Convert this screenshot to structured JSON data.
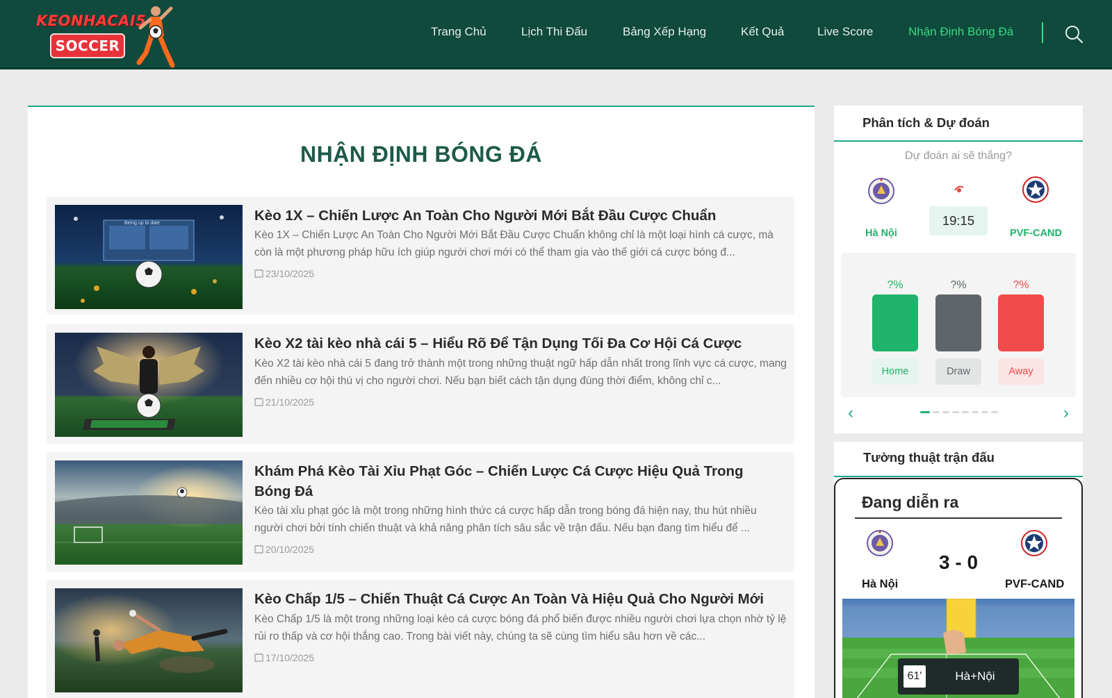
{
  "brand": {
    "line1": "KEONHACAI5",
    "badge": "SOCCER"
  },
  "nav": {
    "items": [
      {
        "label": "Trang Chủ"
      },
      {
        "label": "Lịch Thi Đấu"
      },
      {
        "label": "Bảng Xếp Hạng"
      },
      {
        "label": "Kết Quả"
      },
      {
        "label": "Live Score"
      },
      {
        "label": "Nhận Định Bóng Đá",
        "active": true
      }
    ],
    "search_icon": "search-icon",
    "active_color": "#38d983"
  },
  "main": {
    "title": "NHẬN ĐỊNH BÓNG ĐÁ",
    "articles": [
      {
        "title": "Kèo 1X – Chiến Lược An Toàn Cho Người Mới Bắt Đầu Cược Chuẩn",
        "excerpt": "Kèo 1X – Chiến Lược An Toàn Cho Người Mới Bắt Đầu Cược Chuẩn không chỉ là một loại hình cá cược, mà còn là một phương pháp hữu ích giúp người chơi mới có thể tham gia vào thế giới cá cược bóng đ...",
        "date": "23/10/2025",
        "thumb_text": "Being up to date"
      },
      {
        "title": "Kèo X2 tài kèo nhà cái 5 – Hiểu Rõ Để Tận Dụng Tối Đa Cơ Hội Cá Cược",
        "excerpt": "Kèo X2 tài kèo nhà cái 5 đang trở thành một trong những thuật ngữ hấp dẫn nhất trong lĩnh vực cá cược, mang đến nhiều cơ hội thú vị cho người chơi. Nếu bạn biết cách tận dụng đúng thời điểm, không chỉ c...",
        "date": "21/10/2025"
      },
      {
        "title": "Khám Phá Kèo Tài Xỉu Phạt Góc – Chiến Lược Cá Cược Hiệu Quả Trong Bóng Đá",
        "excerpt": "Kèo tài xỉu phạt góc là một trong những hình thức cá cược hấp dẫn trong bóng đá hiện nay, thu hút nhiều người chơi bởi tính chiến thuật và khả năng phân tích sâu sắc về trận đấu. Nếu bạn đang tìm hiểu để ...",
        "date": "20/10/2025"
      },
      {
        "title": "Kèo Chấp 1/5 – Chiến Thuật Cá Cược An Toàn Và Hiệu Quả Cho Người Mới",
        "excerpt": "Kèo Chấp 1/5 là một trong những loại kèo cá cược bóng đá phổ biến được nhiều người chơi lựa chọn nhờ tỷ lệ rủi ro thấp và cơ hội thắng cao. Trong bài viết này, chúng ta sẽ cùng tìm hiểu sâu hơn về các...",
        "date": "17/10/2025"
      }
    ]
  },
  "prediction": {
    "title": "Phân tích & Dự đoán",
    "question": "Dự đoán ai sẽ thắng?",
    "home_team": "Hà Nội",
    "away_team": "PVF-CAND",
    "time": "19:15",
    "options": [
      {
        "pct": "?%",
        "label": "Home",
        "color": "#1fb36b"
      },
      {
        "pct": "?%",
        "label": "Draw",
        "color": "#5f666b"
      },
      {
        "pct": "?%",
        "label": "Away",
        "color": "#ef4b4b"
      }
    ],
    "prev_label": "‹",
    "next_label": "›"
  },
  "live": {
    "title": "Tường thuật trận đấu",
    "status": "Đang diễn ra",
    "score": "3 - 0",
    "home_team": "Hà Nội",
    "away_team": "PVF-CAND",
    "event_minute": "61'",
    "event_team": "Hà+Nội",
    "event_icon": "yellow-card-icon"
  }
}
